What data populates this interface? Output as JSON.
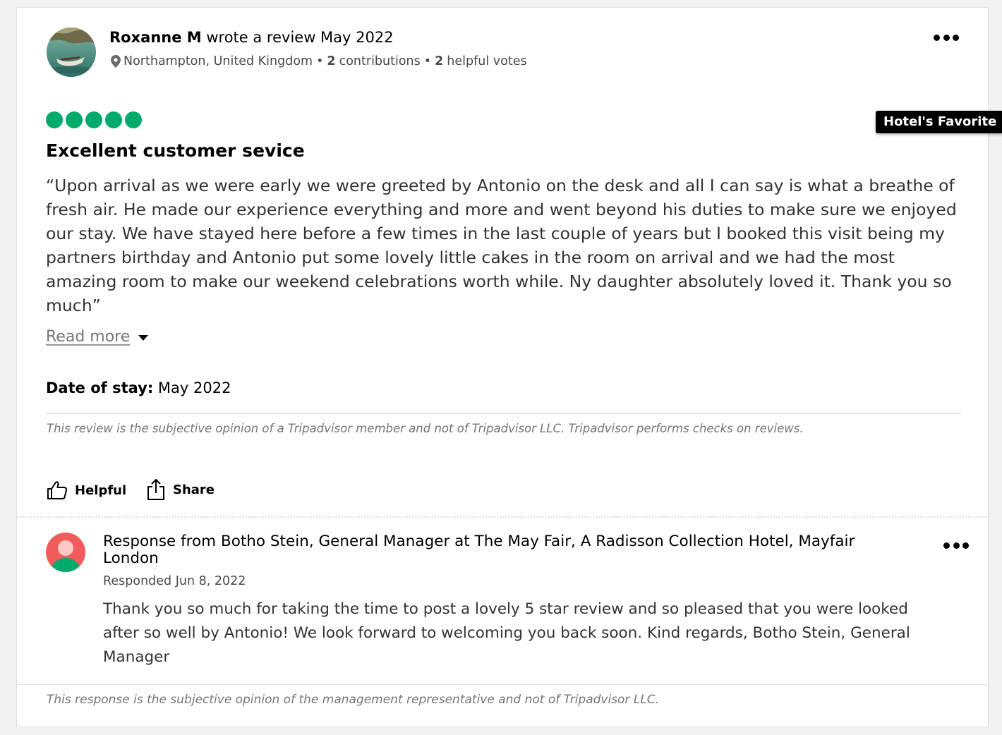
{
  "review": {
    "author": "Roxanne M",
    "wrote_text": "wrote a review May 2022",
    "location": "Northampton, United Kingdom",
    "sep1": "•",
    "contributions_count": "2",
    "contributions_label": "contributions",
    "sep2": "•",
    "helpful_votes_count": "2",
    "helpful_votes_label": "helpful votes",
    "rating": 5,
    "rating_max": 5,
    "badge": "Hotel's Favorite",
    "title": "Excellent customer sevice",
    "body": "“Upon arrival as we were early we were greeted by Antonio on the desk and all I can say is what a breathe of fresh air. He made our experience everything and more and went beyond his duties to make sure we enjoyed our stay. We have stayed here before a few times in the last couple of years but I booked this visit being my partners birthday and Antonio put some lovely little cakes in the room on arrival and we had the most amazing room to make our weekend celebrations worth while. Ny daughter absolutely loved it. Thank you so much”",
    "read_more": "Read more",
    "date_of_stay_label": "Date of stay:",
    "date_of_stay_value": "May 2022",
    "disclaimer": "This review is the subjective opinion of a Tripadvisor member and not of Tripadvisor LLC. Tripadvisor performs checks on reviews."
  },
  "actions": {
    "helpful": "Helpful",
    "share": "Share"
  },
  "response": {
    "title": "Response from Botho Stein, General Manager at The May Fair, A Radisson Collection Hotel, Mayfair London",
    "date": "Responded Jun 8, 2022",
    "body": "Thank you so much for taking the time to post a lovely 5 star review and so pleased that you were looked after so well by Antonio! We look forward to welcoming you back soon. Kind regards, Botho Stein, General Manager",
    "disclaimer": "This response is the subjective opinion of the management representative and not of Tripadvisor LLC."
  },
  "colors": {
    "rating_green": "#00aa6c",
    "badge_bg": "#000000",
    "response_avatar_bg": "#f25b5b",
    "response_avatar_body": "#00aa6c"
  },
  "icons": {
    "location": "map-pin-icon",
    "more": "more-options-icon",
    "helpful": "thumbs-up-icon",
    "share": "share-icon"
  }
}
